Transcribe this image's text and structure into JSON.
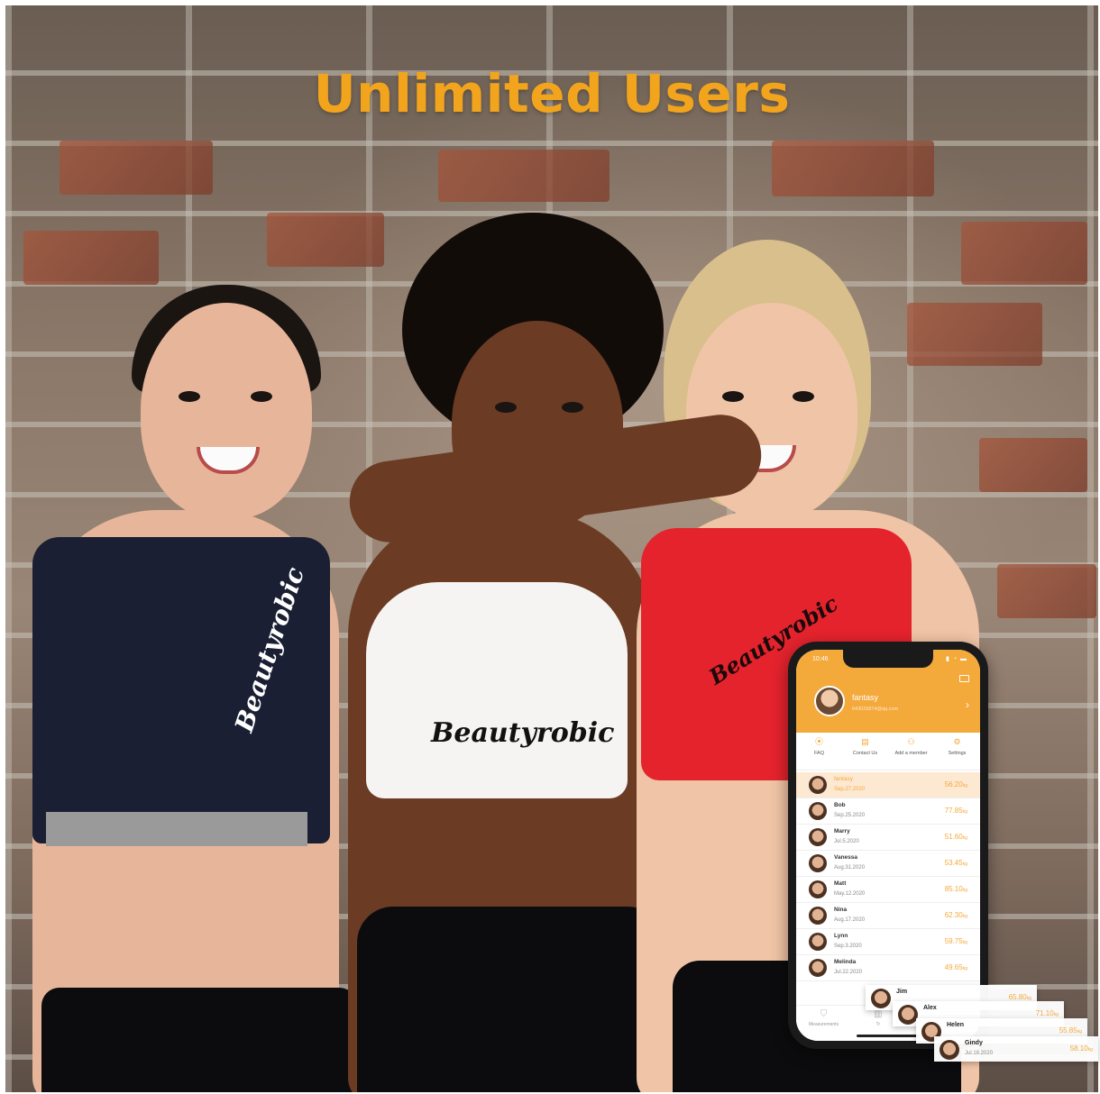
{
  "title": "Unlimited Users",
  "brand_logo": "Beautyrobic",
  "phone": {
    "status_time": "10:46",
    "profile": {
      "name": "fantasy",
      "email": "643029874@qq.com"
    },
    "menu": [
      {
        "label": "FAQ",
        "icon": "location-pin-icon"
      },
      {
        "label": "Contact Us",
        "icon": "document-icon"
      },
      {
        "label": "Add a member",
        "icon": "add-person-icon"
      },
      {
        "label": "Settings",
        "icon": "gear-icon"
      }
    ],
    "users": [
      {
        "name": "fantasy",
        "date": "Sep.27.2020",
        "weight": "56.20",
        "unit": "kg",
        "active": true
      },
      {
        "name": "Bob",
        "date": "Sep.25.2020",
        "weight": "77.85",
        "unit": "kg"
      },
      {
        "name": "Marry",
        "date": "Jul.5.2020",
        "weight": "51.60",
        "unit": "kg"
      },
      {
        "name": "Vanessa",
        "date": "Aug.31.2020",
        "weight": "53.45",
        "unit": "kg"
      },
      {
        "name": "Matt",
        "date": "May.12.2020",
        "weight": "85.10",
        "unit": "kg"
      },
      {
        "name": "Nina",
        "date": "Aug.17.2020",
        "weight": "62.30",
        "unit": "kg"
      },
      {
        "name": "Lynn",
        "date": "Sep.3.2020",
        "weight": "59.75",
        "unit": "kg"
      },
      {
        "name": "Melinda",
        "date": "Jul.22.2020",
        "weight": "49.65",
        "unit": "kg"
      }
    ],
    "tabs": [
      {
        "label": "Measurements",
        "icon": "shield-icon"
      },
      {
        "label": "Tr",
        "icon": "chart-icon"
      }
    ]
  },
  "popups": [
    {
      "name": "Jim",
      "date": "",
      "weight": "65.80",
      "unit": "kg"
    },
    {
      "name": "Alex",
      "date": "",
      "weight": "71.10",
      "unit": "kg"
    },
    {
      "name": "Helen",
      "date": "",
      "weight": "55.85",
      "unit": "kg"
    },
    {
      "name": "Gindy",
      "date": "Jul.18.2020",
      "weight": "58.10",
      "unit": "kg"
    }
  ],
  "colors": {
    "title": "#f2a51c",
    "app_accent": "#f4a93b",
    "top_left": "#1a1f33",
    "top_middle": "#f6f4f3",
    "top_right": "#e4232d"
  }
}
